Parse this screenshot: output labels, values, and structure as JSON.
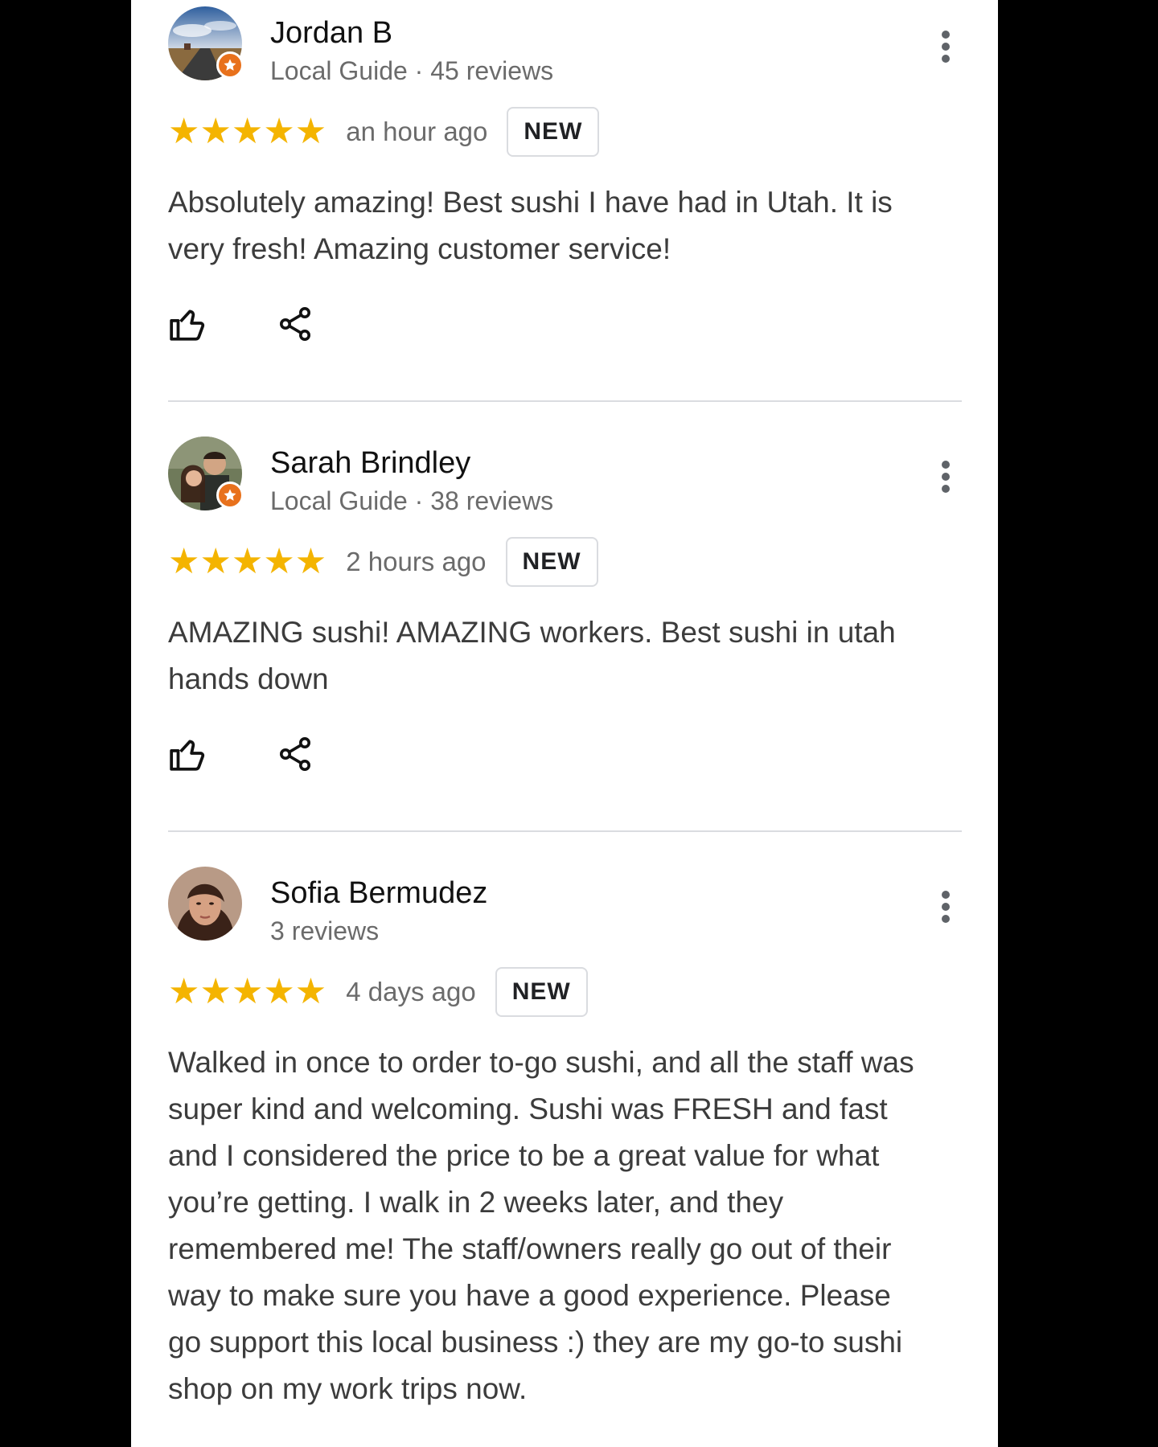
{
  "colors": {
    "star": "#f4b400",
    "local_guide_badge": "#e8711c",
    "text_primary": "#111111",
    "text_secondary": "#6b6b6b"
  },
  "reviews": [
    {
      "author": "Jordan B",
      "meta": "Local Guide · 45 reviews",
      "local_guide": true,
      "stars": "★★★★★",
      "rating": 5,
      "time": "an hour ago",
      "badge": "NEW",
      "text": "Absolutely amazing! Best sushi I have had in Utah. It is very fresh! Amazing customer service!",
      "icons": {
        "like": "thumbs-up-icon",
        "share": "share-icon",
        "more": "more-vert-icon"
      }
    },
    {
      "author": "Sarah Brindley",
      "meta": "Local Guide · 38 reviews",
      "local_guide": true,
      "stars": "★★★★★",
      "rating": 5,
      "time": "2 hours ago",
      "badge": "NEW",
      "text": "AMAZING sushi! AMAZING workers. Best sushi in utah hands down",
      "icons": {
        "like": "thumbs-up-icon",
        "share": "share-icon",
        "more": "more-vert-icon"
      }
    },
    {
      "author": "Sofia Bermudez",
      "meta": "3 reviews",
      "local_guide": false,
      "stars": "★★★★★",
      "rating": 5,
      "time": "4 days ago",
      "badge": "NEW",
      "text": "Walked in once to order to-go sushi, and all the staff was super kind and welcoming. Sushi was FRESH and fast and I considered the price to be a great value for what you’re getting. I walk in 2 weeks later, and they remembered me! The staff/owners really go out of their way to make sure you have a good experience. Please go support this local business :) they are my go-to sushi shop on my work trips now.",
      "icons": {
        "more": "more-vert-icon"
      }
    }
  ]
}
